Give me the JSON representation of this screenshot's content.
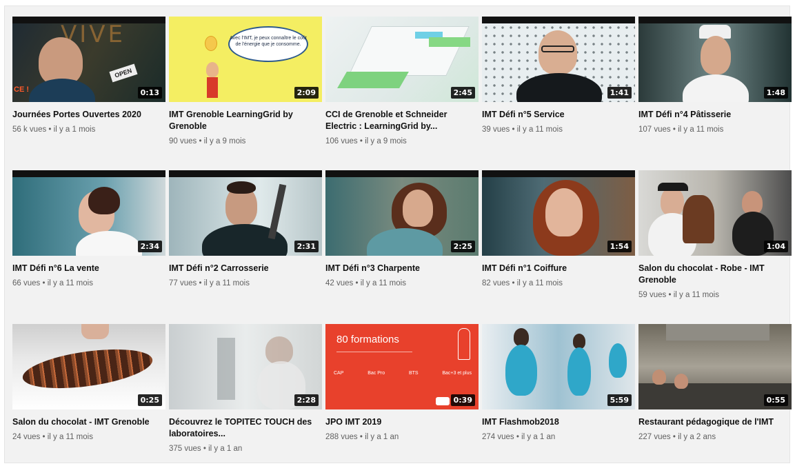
{
  "videos": [
    {
      "title": "Journées Portes Ouvertes 2020",
      "meta": "56 k vues • il y a 1 mois",
      "duration": "0:13"
    },
    {
      "title": "IMT Grenoble LearningGrid by Grenoble",
      "meta": "90 vues • il y a 9 mois",
      "duration": "2:09"
    },
    {
      "title": "CCI de Grenoble et Schneider Electric : LearningGrid by...",
      "meta": "106 vues • il y a 9 mois",
      "duration": "2:45"
    },
    {
      "title": "IMT Défi n°5 Service",
      "meta": "39 vues • il y a 11 mois",
      "duration": "1:41"
    },
    {
      "title": "IMT Défi n°4 Pâtisserie",
      "meta": "107 vues • il y a 11 mois",
      "duration": "1:48"
    },
    {
      "title": "IMT Défi n°6 La vente",
      "meta": "66 vues • il y a 11 mois",
      "duration": "2:34"
    },
    {
      "title": "IMT Défi n°2 Carrosserie",
      "meta": "77 vues • il y a 11 mois",
      "duration": "2:31"
    },
    {
      "title": "IMT Défi n°3 Charpente",
      "meta": "42 vues • il y a 11 mois",
      "duration": "2:25"
    },
    {
      "title": "IMT Défi n°1 Coiffure",
      "meta": "82 vues • il y a 11 mois",
      "duration": "1:54"
    },
    {
      "title": "Salon du chocolat - Robe - IMT Grenoble",
      "meta": "59 vues • il y a 11 mois",
      "duration": "1:04"
    },
    {
      "title": "Salon du chocolat - IMT Grenoble",
      "meta": "24 vues • il y a 11 mois",
      "duration": "0:25"
    },
    {
      "title": "Découvrez le TOPITEC TOUCH des laboratoires...",
      "meta": "375 vues • il y a 1 an",
      "duration": "2:28"
    },
    {
      "title": "JPO IMT 2019",
      "meta": "288 vues • il y a 1 an",
      "duration": "0:39"
    },
    {
      "title": "IMT Flashmob2018",
      "meta": "274 vues • il y a 1 an",
      "duration": "5:59"
    },
    {
      "title": "Restaurant pédagogique de l'IMT",
      "meta": "227 vues • il y a 2 ans",
      "duration": "0:55"
    }
  ],
  "thumb_text": {
    "vive": "VIVE",
    "open": "OPEN",
    "ce": "CE !",
    "bubble": "Avec l'IMT, je peux connaître le coût de l'énergie que je consomme.",
    "promo_title": "80 formations",
    "promo_items": [
      "CAP",
      "Bac Pro",
      "BTS",
      "Bac+3 et plus"
    ]
  }
}
